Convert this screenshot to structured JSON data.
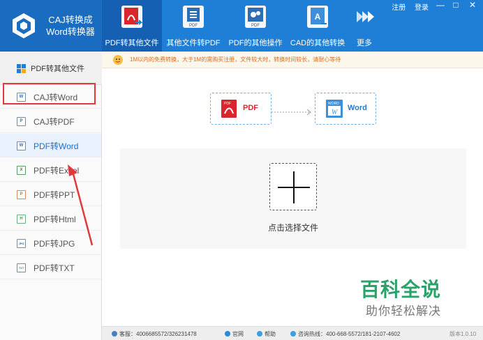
{
  "app": {
    "logo_line1": "CAJ转换成",
    "logo_line2": "Word转换器"
  },
  "nav": {
    "items": [
      {
        "label": "PDF转其他文件",
        "icon": "pdf-icon"
      },
      {
        "label": "其他文件转PDF",
        "icon": "document-to-pdf-icon"
      },
      {
        "label": "PDF的其他操作",
        "icon": "gear-pdf-icon"
      },
      {
        "label": "CAD的其他转换",
        "icon": "cad-icon"
      },
      {
        "label": "更多",
        "icon": "double-chevron-icon"
      }
    ]
  },
  "window": {
    "register": "注册",
    "login": "登录",
    "minimize": "—",
    "restore": "□",
    "close": "✕"
  },
  "sidebar": {
    "header": "PDF转其他文件",
    "items": [
      {
        "label": "CAJ转Word",
        "badge": "W"
      },
      {
        "label": "CAJ转PDF",
        "badge": "P"
      },
      {
        "label": "PDF转Word",
        "badge": "W"
      },
      {
        "label": "PDF转Excel",
        "badge": "X"
      },
      {
        "label": "PDF转PPT",
        "badge": "P"
      },
      {
        "label": "PDF转Html",
        "badge": "H"
      },
      {
        "label": "PDF转JPG",
        "badge": "JPG"
      },
      {
        "label": "PDF转TXT",
        "badge": "TXT"
      }
    ]
  },
  "notice": "1M以内的免费转换，大于1M的需购买注册，文件较大时，转换时间较长，请耐心等待",
  "flow": {
    "from": "PDF",
    "from_badge": "PDF",
    "to": "Word",
    "to_badge": "WORD"
  },
  "dropzone": {
    "label": "点击选择文件"
  },
  "watermark": {
    "line1": "百科全说",
    "line2": "助你轻松解决"
  },
  "status": {
    "service": "客服：4006685572/326231478",
    "website": "官网",
    "help": "帮助",
    "hotline": "咨询热线：400-668-5572/181-2107-4602",
    "version": "版本1.0.10"
  },
  "colors": {
    "topbar": "#1f7fd6",
    "active_tab": "#1560b3",
    "highlight": "#e0393b",
    "accent_blue": "#1f6fc8",
    "pdf_red": "#d9262c",
    "watermark_green": "#2aa36a"
  }
}
